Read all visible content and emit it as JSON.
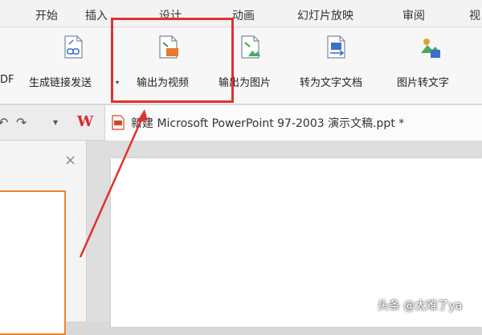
{
  "menu": [
    "开始",
    "插入",
    "设计",
    "动画",
    "幻灯片放映",
    "审阅",
    "视"
  ],
  "ribbon": {
    "pdf_label": "DF",
    "items": [
      {
        "label": "生成链接发送",
        "icon": "share-link-icon"
      },
      {
        "label": "输出为视频",
        "icon": "export-video-icon"
      },
      {
        "label": "输出为图片",
        "icon": "export-image-icon"
      },
      {
        "label": "转为文字文档",
        "icon": "convert-to-word-icon"
      },
      {
        "label": "图片转文字",
        "icon": "image-to-text-icon"
      }
    ],
    "dropdown_arrow": "▾"
  },
  "quick_access": {
    "undo": "↶",
    "redo": "↷",
    "more": "▾",
    "logo": "W"
  },
  "document": {
    "title": "新建 Microsoft PowerPoint 97-2003 演示文稿.ppt *"
  },
  "panel": {
    "close": "×"
  },
  "watermark": "头条 @太难了ya",
  "colors": {
    "highlight": "#e0322d",
    "thumb_border": "#e8862a",
    "logo": "#d9272e"
  }
}
